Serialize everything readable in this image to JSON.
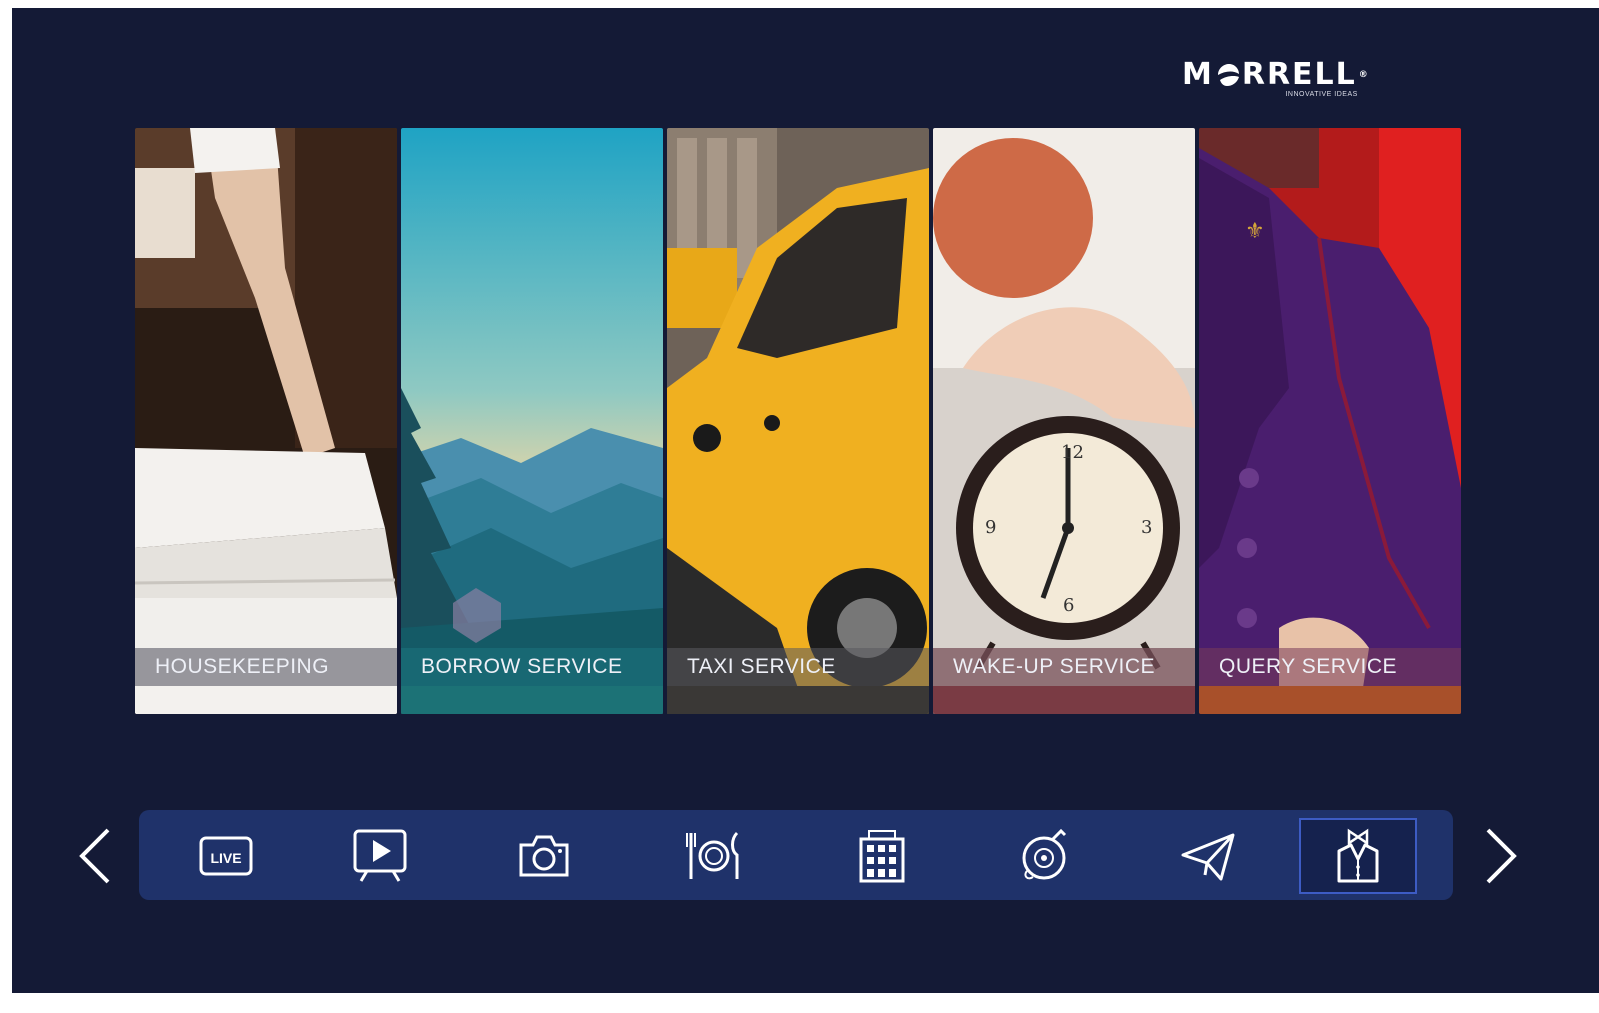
{
  "brand": {
    "name_before": "M",
    "name_after": "RRELL",
    "reg_mark": "®",
    "tagline": "INNOVATIVE IDEAS"
  },
  "cards": [
    {
      "label": "HOUSEKEEPING"
    },
    {
      "label": "BORROW SERVICE"
    },
    {
      "label": "TAXI SERVICE"
    },
    {
      "label": "WAKE-UP SERVICE"
    },
    {
      "label": "QUERY  SERVICE"
    }
  ],
  "nav": {
    "items": [
      {
        "icon": "live-tv-icon",
        "text": "LIVE"
      },
      {
        "icon": "play-video-icon"
      },
      {
        "icon": "camera-icon"
      },
      {
        "icon": "restaurant-icon"
      },
      {
        "icon": "hotel-building-icon"
      },
      {
        "icon": "music-disc-icon"
      },
      {
        "icon": "paper-plane-icon"
      },
      {
        "icon": "butler-service-icon",
        "selected": true
      }
    ],
    "prev_icon": "chevron-left-icon",
    "next_icon": "chevron-right-icon"
  },
  "colors": {
    "background": "#141a36",
    "nav_bar": "#1f326a",
    "active_border": "#3d5cc4",
    "text": "#eef0f7"
  }
}
